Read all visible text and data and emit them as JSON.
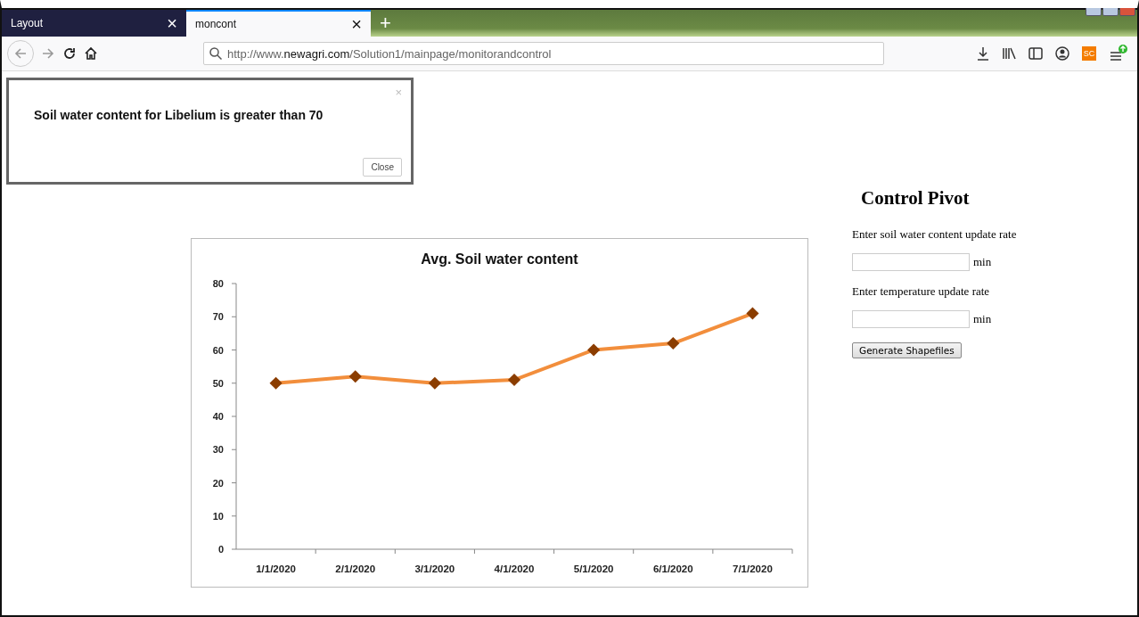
{
  "tabs": [
    {
      "label": "Layout",
      "close": "×",
      "selected": false
    },
    {
      "label": "moncont",
      "close": "×",
      "selected": true
    }
  ],
  "new_tab": "+",
  "address_bar": {
    "url": "http://www.**newagri.com**/Solution1/mainpage/monitorandcontrol"
  },
  "profile_badge": "SC",
  "alert": {
    "close": "×",
    "message": "Soil water content for Libelium is greater than 70",
    "button": "Close"
  },
  "chart": {
    "chart_data": {
      "type": "line",
      "title": "Avg. Soil water content",
      "categories": [
        "1/1/2020",
        "2/1/2020",
        "3/1/2020",
        "4/1/2020",
        "5/1/2020",
        "6/1/2020",
        "7/1/2020"
      ],
      "series": [
        {
          "color": "#f28e3c",
          "marker": "diamond",
          "values": [
            50,
            52,
            50,
            51,
            60,
            62,
            71
          ]
        }
      ],
      "ylim": [
        0,
        80
      ],
      "yticks": [
        0,
        10,
        20,
        30,
        40,
        50,
        60,
        70,
        80
      ]
    }
  },
  "control": {
    "title": "Control Pivot",
    "fields": [
      {
        "label": "Enter soil water content update rate",
        "unit": "min"
      },
      {
        "label": "Enter temperature update rate",
        "unit": "min"
      }
    ],
    "button": "Generate Shapefiles"
  }
}
